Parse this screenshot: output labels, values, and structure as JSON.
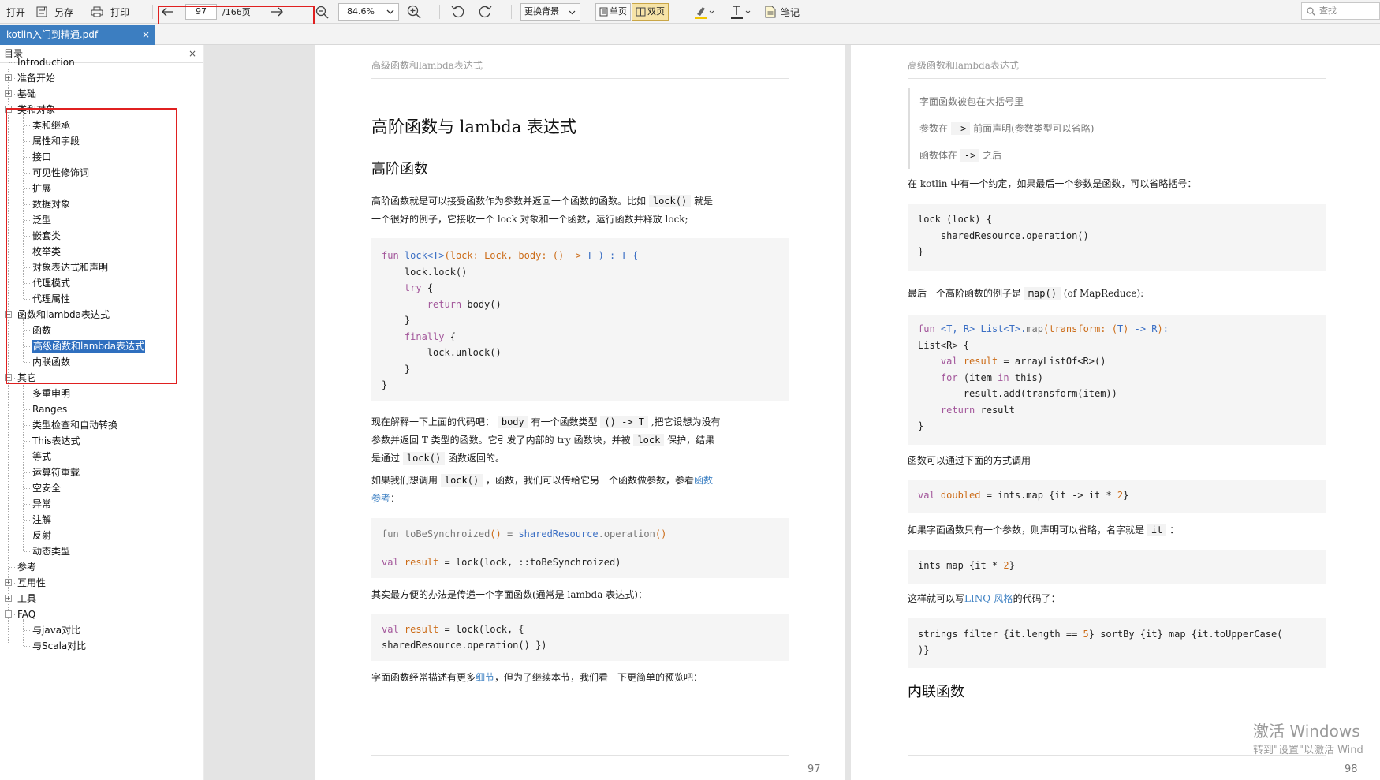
{
  "toolbar": {
    "open_label": "打开",
    "saveas_label": "另存",
    "print_label": "打印",
    "page_current": "97",
    "page_total": "/166页",
    "zoom_value": "84.6%",
    "background_label": "更换背景",
    "single_page_label": "单页",
    "double_page_label": "双页",
    "notes_label": "笔记",
    "search_placeholder": "查找"
  },
  "tabs": [
    {
      "label": "kotlin入门到精通.pdf",
      "close": "×"
    }
  ],
  "sidebar": {
    "title": "目录",
    "close": "×",
    "items": [
      {
        "label": "Introduction",
        "level": 0,
        "expander": ""
      },
      {
        "label": "准备开始",
        "level": 0,
        "expander": "+"
      },
      {
        "label": "基础",
        "level": 0,
        "expander": "+"
      },
      {
        "label": "类和对象",
        "level": 0,
        "expander": "−"
      },
      {
        "label": "类和继承",
        "level": 1,
        "expander": ""
      },
      {
        "label": "属性和字段",
        "level": 1,
        "expander": ""
      },
      {
        "label": "接口",
        "level": 1,
        "expander": ""
      },
      {
        "label": "可见性修饰词",
        "level": 1,
        "expander": ""
      },
      {
        "label": "扩展",
        "level": 1,
        "expander": ""
      },
      {
        "label": "数据对象",
        "level": 1,
        "expander": ""
      },
      {
        "label": "泛型",
        "level": 1,
        "expander": ""
      },
      {
        "label": "嵌套类",
        "level": 1,
        "expander": ""
      },
      {
        "label": "枚举类",
        "level": 1,
        "expander": ""
      },
      {
        "label": "对象表达式和声明",
        "level": 1,
        "expander": ""
      },
      {
        "label": "代理模式",
        "level": 1,
        "expander": ""
      },
      {
        "label": "代理属性",
        "level": 1,
        "expander": ""
      },
      {
        "label": "函数和lambda表达式",
        "level": 0,
        "expander": "−"
      },
      {
        "label": "函数",
        "level": 1,
        "expander": ""
      },
      {
        "label": "高级函数和lambda表达式",
        "level": 1,
        "expander": "",
        "selected": true
      },
      {
        "label": "内联函数",
        "level": 1,
        "expander": ""
      },
      {
        "label": "其它",
        "level": 0,
        "expander": "−"
      },
      {
        "label": "多重申明",
        "level": 1,
        "expander": ""
      },
      {
        "label": "Ranges",
        "level": 1,
        "expander": ""
      },
      {
        "label": "类型检查和自动转换",
        "level": 1,
        "expander": ""
      },
      {
        "label": "This表达式",
        "level": 1,
        "expander": ""
      },
      {
        "label": "等式",
        "level": 1,
        "expander": ""
      },
      {
        "label": "运算符重载",
        "level": 1,
        "expander": ""
      },
      {
        "label": "空安全",
        "level": 1,
        "expander": ""
      },
      {
        "label": "异常",
        "level": 1,
        "expander": ""
      },
      {
        "label": "注解",
        "level": 1,
        "expander": ""
      },
      {
        "label": "反射",
        "level": 1,
        "expander": ""
      },
      {
        "label": "动态类型",
        "level": 1,
        "expander": ""
      },
      {
        "label": "参考",
        "level": 0,
        "expander": ""
      },
      {
        "label": "互用性",
        "level": 0,
        "expander": "+"
      },
      {
        "label": "工具",
        "level": 0,
        "expander": "+"
      },
      {
        "label": "FAQ",
        "level": 0,
        "expander": "−"
      },
      {
        "label": "与java对比",
        "level": 1,
        "expander": ""
      },
      {
        "label": "与Scala对比",
        "level": 1,
        "expander": ""
      }
    ]
  },
  "page_left": {
    "running_head": "高级函数和lambda表达式",
    "title": "高阶函数与 lambda 表达式",
    "subtitle": "高阶函数",
    "p1a": "高阶函数就是可以接受函数作为参数并返回一个函数的函数。比如",
    "p1_code": "lock()",
    "p1b": "就是",
    "p1c": "一个很好的例子，它接收一个 lock 对象和一个函数，运行函数并释放 lock;",
    "code1": [
      [
        "fun lock<T>(lock: Lock, body: () -> T ) : T {"
      ],
      [
        "    lock.lock()"
      ],
      [
        "    try {"
      ],
      [
        "        return body()"
      ],
      [
        "    }"
      ],
      [
        "    finally {"
      ],
      [
        "        lock.unlock()"
      ],
      [
        "    }"
      ],
      [
        "}"
      ]
    ],
    "p2a": "现在解释一下上面的代码吧：",
    "p2_code1": "body",
    "p2b": "有一个函数类型",
    "p2_code2": "() -> T",
    "p2c": ",把它设想为没有",
    "p2d": "参数并返回 T 类型的函数。它引发了内部的 try 函数块，并被",
    "p2_code3": "lock",
    "p2e": "保护，结果",
    "p2f": "是通过",
    "p2_code4": "lock()",
    "p2g": "函数返回的。",
    "p3a": "如果我们想调用",
    "p3_code": "lock()",
    "p3b": "，函数，我们可以传给它另一个函数做参数，参看",
    "p3_link1": "函数",
    "p3_link2": "参考",
    "p3c": "：",
    "code2_line1": "fun toBeSynchroized() = sharedResource.operation()",
    "code2_line2": "val result = lock(lock, ::toBeSynchroized)",
    "p4": "其实最方便的办法是传递一个字面函数(通常是 lambda 表达式)：",
    "code3_line1": "val result = lock(lock, {",
    "code3_line2": "sharedResource.operation() })",
    "p5a": "字面函数经常描述有更多",
    "p5_link": "细节",
    "p5b": "，但为了继续本节，我们看一下更简单的预览吧：",
    "page_number": "97"
  },
  "page_right": {
    "running_head": "高级函数和lambda表达式",
    "q1": "字面函数被包在大括号里",
    "q2a": "参数在",
    "q2_code": "->",
    "q2b": "前面声明(参数类型可以省略)",
    "q3a": "函数体在",
    "q3_code": "->",
    "q3b": "之后",
    "p1": "在 kotlin 中有一个约定，如果最后一个参数是函数，可以省略括号：",
    "code1": [
      "lock (lock) {",
      "    sharedResource.operation()",
      "}"
    ],
    "p2a": "最后一个高阶函数的例子是",
    "p2_code": "map()",
    "p2b": "(of MapReduce):",
    "p3": "函数可以通过下面的方式调用",
    "code4": "val doubled = ints.map {it -> it * 2}",
    "p4a": "如果字面函数只有一个参数，则声明可以省略，名字就是",
    "p4_code": "it",
    "p4b": "：",
    "code5": "ints map {it * 2}",
    "p5a": "这样就可以写",
    "p5_link": "LINQ-风格",
    "p5b": "的代码了：",
    "code6_line1": "strings filter {it.length == 5} sortBy {it} map {it.toUpperCase(",
    "code6_line2": ")}",
    "h_next": "内联函数",
    "page_number": "98"
  },
  "watermark": {
    "line1": "激活 Windows",
    "line2": "转到\"设置\"以激活 Wind"
  },
  "colors": {
    "tab_active": "#3c7ec1",
    "selection": "#2f6fbf",
    "annotation_red": "#e02020",
    "link": "#4183c4"
  }
}
